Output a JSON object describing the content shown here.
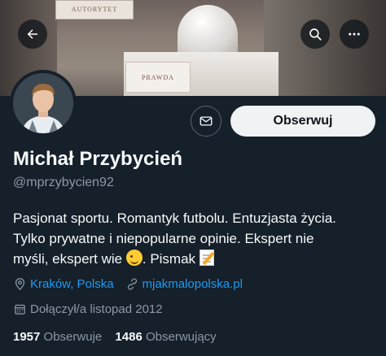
{
  "banner": {
    "sign_top": "AUTORYTET",
    "sign_mid": "PRAWDA"
  },
  "header": {
    "back_icon": "arrow-left-icon",
    "search_icon": "search-icon",
    "more_icon": "more-horizontal-icon"
  },
  "profile": {
    "name": "Michał Przybycień",
    "handle": "@mprzybycien92",
    "follow_label": "Obserwuj",
    "message_icon": "envelope-icon",
    "bio_lines": [
      "Pasjonat sportu. Romantyk futbolu. Entuzjasta życia.",
      "Tylko prywatne i niepopularne opinie. Ekspert nie",
      "myśli, ekspert wie",
      ". Pismak"
    ],
    "location": "Kraków, Polska",
    "website": "mjakmalopolska.pl",
    "joined": "Dołączył/a listopad 2012",
    "following_count": "1957",
    "following_label": "Obserwuje",
    "followers_count": "1486",
    "followers_label": "Obserwujący"
  },
  "colors": {
    "background": "#15202b",
    "accent": "#1d9bf0",
    "secondary_text": "#8b98a5",
    "button_bg": "#eff3f4"
  }
}
